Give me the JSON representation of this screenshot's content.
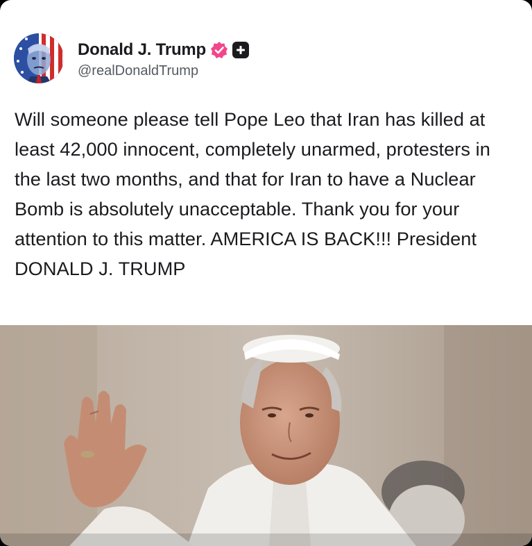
{
  "post": {
    "author": {
      "display_name": "Donald J. Trump",
      "handle": "@realDonaldTrump",
      "avatar_icon": "avatar-flag-portrait-icon",
      "verified_icon": "verified-badge-icon",
      "verified_color": "#f0468c",
      "follow_icon": "follow-plus-icon"
    },
    "text": "Will someone please tell Pope Leo that Iran has killed at least 42,000 innocent, completely unarmed, protesters in the last two months, and that for Iran to have a Nuclear Bomb is absolutely unacceptable. Thank you for your attention to this matter. AMERICA IS BACK!!! President DONALD J. TRUMP",
    "media": {
      "type": "photo",
      "icon": "photo-pope-waving-icon"
    }
  },
  "colors": {
    "background": "#ffffff",
    "text": "#1b1b1f",
    "handle": "#555a61",
    "frame": "#000000"
  }
}
